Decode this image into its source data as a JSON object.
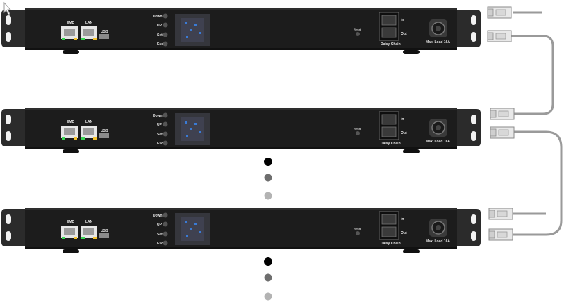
{
  "units": [
    {
      "ports": {
        "emd": "EMD",
        "lan": "LAN",
        "usb": "USB"
      },
      "buttons": [
        "Down",
        "UP",
        "Set",
        "Esc"
      ],
      "reset": "Reset",
      "daisy": {
        "in": "In",
        "out": "Out",
        "title": "Daisy Chain"
      },
      "max_load": "Max. Load 16A"
    },
    {
      "ports": {
        "emd": "EMD",
        "lan": "LAN",
        "usb": "USB"
      },
      "buttons": [
        "Down",
        "UP",
        "Set",
        "Esc"
      ],
      "reset": "Reset",
      "daisy": {
        "in": "In",
        "out": "Out",
        "title": "Daisy Chain"
      },
      "max_load": "Max. Load 16A"
    },
    {
      "ports": {
        "emd": "EMD",
        "lan": "LAN",
        "usb": "USB"
      },
      "buttons": [
        "Down",
        "UP",
        "Set",
        "Esc"
      ],
      "reset": "Reset",
      "daisy": {
        "in": "In",
        "out": "Out",
        "title": "Daisy Chain"
      },
      "max_load": "Max. Load 16A"
    }
  ],
  "colors": {
    "chassis": "#1c1c1c",
    "bracket": "#2b2b2b",
    "display": "#3a7bd5",
    "led_green": "#39d353",
    "led_yellow": "#f2c12e",
    "cable": "#9a9a9a",
    "dot_black": "#000000",
    "dot_dark_gray": "#6e6e6e",
    "dot_light_gray": "#b3b3b3"
  }
}
